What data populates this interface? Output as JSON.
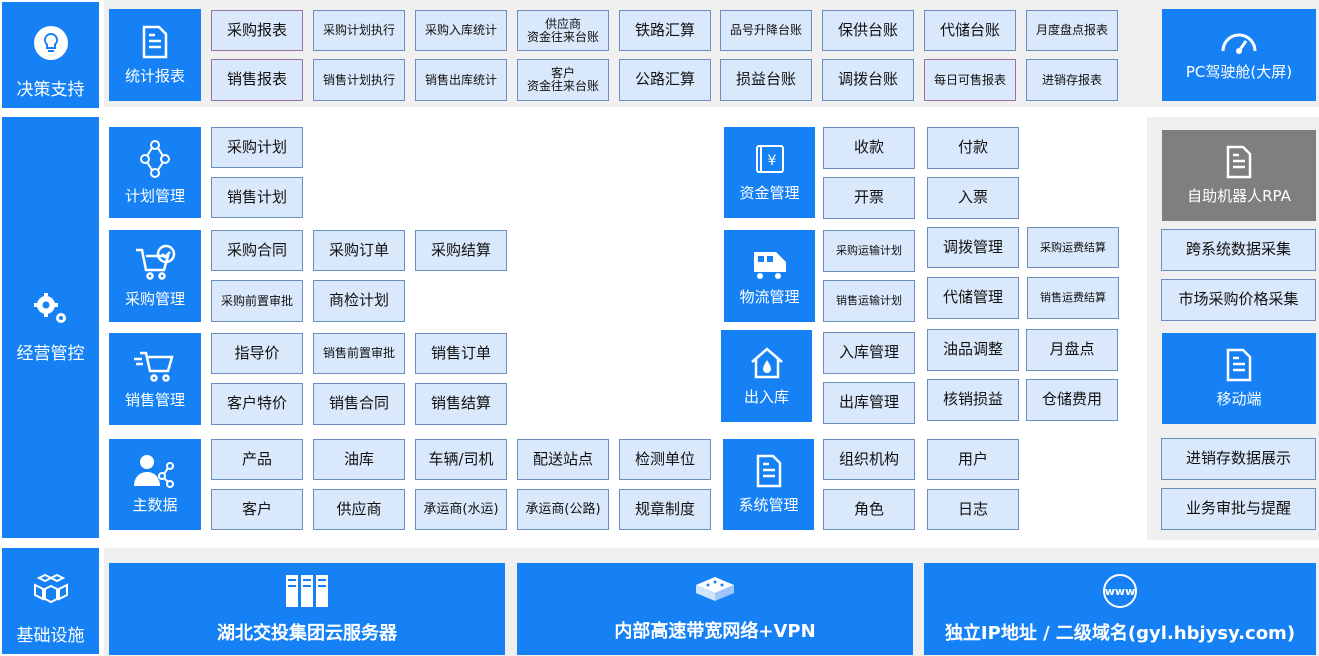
{
  "colors": {
    "primary_blue": "#1681f5",
    "cell_fill": "#dae8fc",
    "cell_border": "#6c8ebf",
    "band_gray": "#f0f0f0",
    "rpa_gray": "#7f7f7f"
  },
  "side": {
    "decision": "决策支持",
    "operations": "经营管控",
    "infrastructure": "基础设施"
  },
  "stats": {
    "title": "统计报表",
    "row1": [
      "采购报表",
      "采购计划执行",
      "采购入库统计",
      "供应商\n资金往来台账",
      "铁路汇算",
      "品号升降台账",
      "保供台账",
      "代储台账",
      "月度盘点报表"
    ],
    "row2": [
      "销售报表",
      "销售计划执行",
      "销售出库统计",
      "客户\n资金往来台账",
      "公路汇算",
      "损益台账",
      "调拨台账",
      "每日可售报表",
      "进销存报表"
    ]
  },
  "cockpit": "PC驾驶舱(大屏)",
  "plan": {
    "title": "计划管理",
    "items": [
      "采购计划",
      "销售计划"
    ]
  },
  "purchase": {
    "title": "采购管理",
    "items": [
      "采购合同",
      "采购订单",
      "采购结算",
      "采购前置审批",
      "商检计划"
    ]
  },
  "sales": {
    "title": "销售管理",
    "items": [
      "指导价",
      "销售前置审批",
      "销售订单",
      "客户特价",
      "销售合同",
      "销售结算"
    ]
  },
  "master": {
    "title": "主数据",
    "items": [
      "产品",
      "油库",
      "车辆/司机",
      "配送站点",
      "检测单位",
      "客户",
      "供应商",
      "承运商(水运)",
      "承运商(公路)",
      "规章制度"
    ]
  },
  "fund": {
    "title": "资金管理",
    "items": [
      "收款",
      "付款",
      "开票",
      "入票"
    ]
  },
  "logistics": {
    "title": "物流管理",
    "items": [
      "采购运输计划",
      "调拨管理",
      "采购运费结算",
      "销售运输计划",
      "代储管理",
      "销售运费结算"
    ]
  },
  "warehouse": {
    "title": "出入库",
    "items": [
      "入库管理",
      "油品调整",
      "月盘点",
      "出库管理",
      "核销损益",
      "仓储费用"
    ]
  },
  "system": {
    "title": "系统管理",
    "items": [
      "组织机构",
      "用户",
      "角色",
      "日志"
    ]
  },
  "right": {
    "rpa": "自助机器人RPA",
    "cross": "跨系统数据采集",
    "market": "市场采购价格采集",
    "mobile": "移动端",
    "inventory": "进销存数据展示",
    "approval": "业务审批与提醒"
  },
  "infra": {
    "cloud": "湖北交投集团云服务器",
    "network": "内部高速带宽网络+VPN",
    "domain": "独立IP地址 / 二级域名(gyl.hbjysy.com)"
  },
  "icons": {
    "decision": "lightbulb-icon",
    "operations": "gears-icon",
    "infrastructure": "cubes-icon",
    "stats": "document-icon",
    "cockpit": "speedometer-icon",
    "plan": "network-nodes-icon",
    "purchase": "cart-check-icon",
    "sales": "cart-icon",
    "master": "user-share-icon",
    "fund": "money-icon",
    "logistics": "train-icon",
    "warehouse": "house-drop-icon",
    "system": "document-icon",
    "rpa": "document-icon",
    "mobile": "document-icon",
    "cloud": "server-icon",
    "network": "network-switch-icon",
    "domain": "www-globe-icon"
  }
}
